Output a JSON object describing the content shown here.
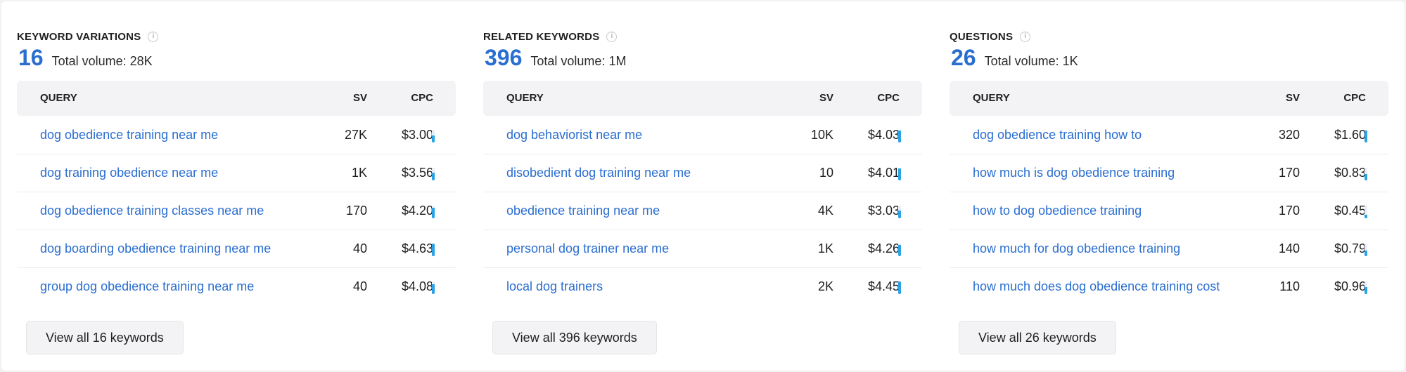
{
  "table_headers": {
    "query": "QUERY",
    "sv": "SV",
    "cpc": "CPC"
  },
  "panels": [
    {
      "title": "KEYWORD VARIATIONS",
      "count": "16",
      "total_volume": "Total volume: 28K",
      "view_all": "View all 16 keywords",
      "rows": [
        {
          "query": "dog obedience training near me",
          "sv": "27K",
          "cpc": "$3.00",
          "competition": 0.55
        },
        {
          "query": "dog training obedience near me",
          "sv": "1K",
          "cpc": "$3.56",
          "competition": 0.6
        },
        {
          "query": "dog obedience training classes near me",
          "sv": "170",
          "cpc": "$4.20",
          "competition": 0.85
        },
        {
          "query": "dog boarding obedience training near me",
          "sv": "40",
          "cpc": "$4.63",
          "competition": 1.0
        },
        {
          "query": "group dog obedience training near me",
          "sv": "40",
          "cpc": "$4.08",
          "competition": 0.8
        }
      ]
    },
    {
      "title": "RELATED KEYWORDS",
      "count": "396",
      "total_volume": "Total volume: 1M",
      "view_all": "View all 396 keywords",
      "rows": [
        {
          "query": "dog behaviorist near me",
          "sv": "10K",
          "cpc": "$4.03",
          "competition": 0.95
        },
        {
          "query": "disobedient dog training near me",
          "sv": "10",
          "cpc": "$4.01",
          "competition": 0.95
        },
        {
          "query": "obedience training near me",
          "sv": "4K",
          "cpc": "$3.03",
          "competition": 0.6
        },
        {
          "query": "personal dog trainer near me",
          "sv": "1K",
          "cpc": "$4.26",
          "competition": 0.9
        },
        {
          "query": "local dog trainers",
          "sv": "2K",
          "cpc": "$4.45",
          "competition": 1.0
        }
      ]
    },
    {
      "title": "QUESTIONS",
      "count": "26",
      "total_volume": "Total volume: 1K",
      "view_all": "View all 26 keywords",
      "rows": [
        {
          "query": "dog obedience training how to",
          "sv": "320",
          "cpc": "$1.60",
          "competition": 0.95
        },
        {
          "query": "how much is dog obedience training",
          "sv": "170",
          "cpc": "$0.83",
          "competition": 0.5
        },
        {
          "query": "how to dog obedience training",
          "sv": "170",
          "cpc": "$0.45",
          "competition": 0.3
        },
        {
          "query": "how much for dog obedience training",
          "sv": "140",
          "cpc": "$0.79",
          "competition": 0.45
        },
        {
          "query": "how much does dog obedience training cost",
          "sv": "110",
          "cpc": "$0.96",
          "competition": 0.55
        }
      ]
    }
  ],
  "colors": {
    "accent": "#2a6ed0",
    "bar": "#27a3e6"
  },
  "icons": {
    "info": "info-icon"
  }
}
